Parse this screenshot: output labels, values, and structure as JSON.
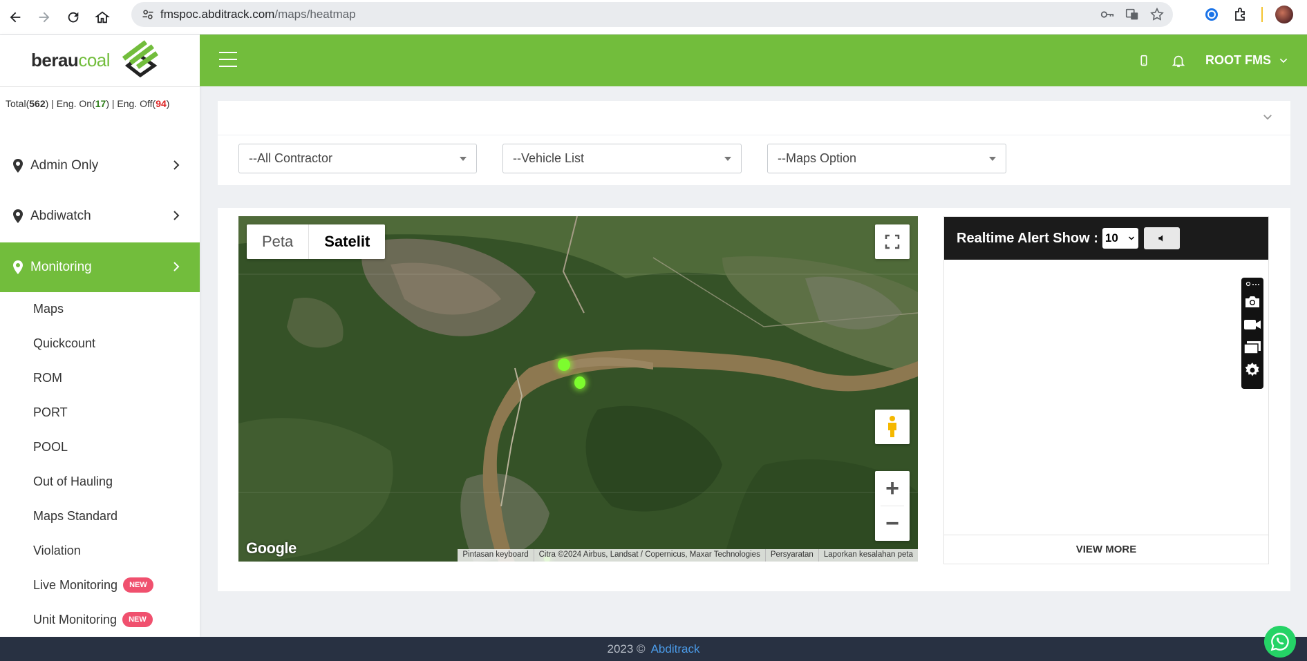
{
  "browser": {
    "url_host": "fmspoc.abditrack.com",
    "url_path": "/maps/heatmap"
  },
  "brand": {
    "name_bold": "berau",
    "name_light": "coal",
    "color": "#72bd3c"
  },
  "stats": {
    "total_label": "Total",
    "total": "562",
    "on_label": "| Eng. On",
    "on": "17",
    "off_label": "| Eng. Off",
    "off": "94"
  },
  "sidebar": {
    "groups": [
      {
        "label": "Admin Only"
      },
      {
        "label": "Abdiwatch"
      },
      {
        "label": "Monitoring"
      }
    ],
    "sub_items": [
      {
        "label": "Maps"
      },
      {
        "label": "Quickcount"
      },
      {
        "label": "ROM"
      },
      {
        "label": "PORT"
      },
      {
        "label": "POOL"
      },
      {
        "label": "Out of Hauling"
      },
      {
        "label": "Maps Standard"
      },
      {
        "label": "Violation"
      },
      {
        "label": "Live Monitoring",
        "badge": "NEW"
      },
      {
        "label": "Unit Monitoring",
        "badge": "NEW"
      }
    ]
  },
  "header": {
    "user": "ROOT FMS"
  },
  "filters": {
    "contractor": "--All Contractor",
    "vehicle": "--Vehicle List",
    "maps_option": "--Maps Option"
  },
  "map": {
    "type_map": "Peta",
    "type_satellite": "Satelit",
    "google": "Google",
    "attribution": {
      "shortcuts": "Pintasan keyboard",
      "imagery": "Citra ©2024 Airbus, Landsat / Copernicus, Maxar Technologies",
      "terms": "Persyaratan",
      "report": "Laporkan kesalahan peta"
    },
    "zoom_in": "+",
    "zoom_out": "−"
  },
  "alerts": {
    "title": "Realtime Alert Show :",
    "count": "10",
    "view_more": "VIEW MORE"
  },
  "footer": {
    "year": "2023 ©",
    "link": "Abditrack"
  }
}
